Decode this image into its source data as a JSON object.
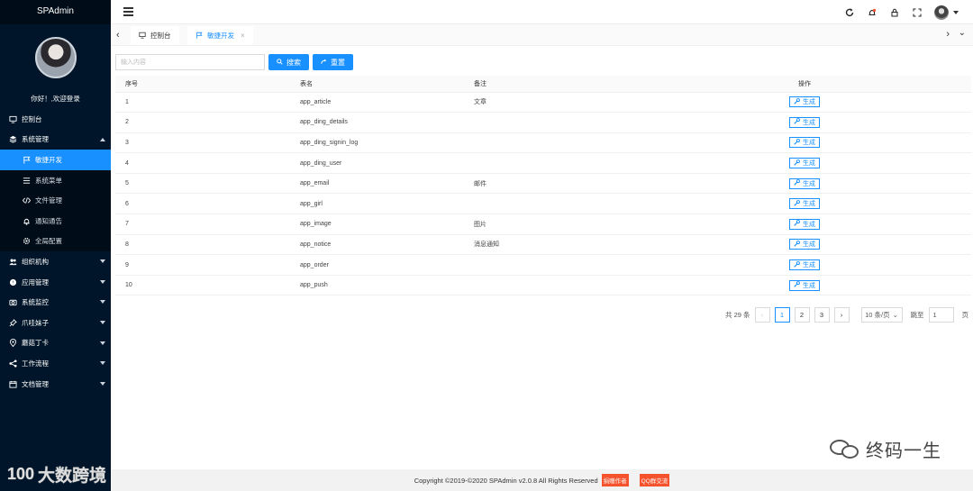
{
  "sidebar": {
    "title": "SPAdmin",
    "welcome": "你好！,欢迎登录",
    "items": [
      {
        "label": "控制台",
        "icon": "monitor-icon"
      },
      {
        "label": "系统管理",
        "icon": "layers-icon",
        "expanded": true,
        "children": [
          {
            "label": "敏捷开发",
            "icon": "flag-icon",
            "active": true
          },
          {
            "label": "系统菜单",
            "icon": "list-icon"
          },
          {
            "label": "文件管理",
            "icon": "code-icon"
          },
          {
            "label": "通知通告",
            "icon": "bell-icon"
          },
          {
            "label": "全局配置",
            "icon": "gear-icon"
          }
        ]
      },
      {
        "label": "组织机构",
        "icon": "users-icon"
      },
      {
        "label": "应用管理",
        "icon": "app-icon"
      },
      {
        "label": "系统监控",
        "icon": "camera-icon"
      },
      {
        "label": "爪哇妹子",
        "icon": "pin-icon"
      },
      {
        "label": "蘑菇丁卡",
        "icon": "location-icon"
      },
      {
        "label": "工作流程",
        "icon": "share-icon"
      },
      {
        "label": "文档管理",
        "icon": "calendar-icon"
      }
    ]
  },
  "tabs": [
    {
      "label": "控制台",
      "icon": "monitor-icon"
    },
    {
      "label": "敏捷开发",
      "icon": "flag-icon",
      "active": true,
      "closable": "×"
    }
  ],
  "search": {
    "placeholder": "输入内容",
    "search_label": "搜索",
    "reset_label": "重置"
  },
  "table": {
    "headers": [
      "序号",
      "表名",
      "备注",
      "操作"
    ],
    "action_label": "生成",
    "rows": [
      {
        "no": "1",
        "name": "app_article",
        "remark": "文章"
      },
      {
        "no": "2",
        "name": "app_ding_details",
        "remark": ""
      },
      {
        "no": "3",
        "name": "app_ding_signin_log",
        "remark": ""
      },
      {
        "no": "4",
        "name": "app_ding_user",
        "remark": ""
      },
      {
        "no": "5",
        "name": "app_email",
        "remark": "邮件"
      },
      {
        "no": "6",
        "name": "app_girl",
        "remark": ""
      },
      {
        "no": "7",
        "name": "app_image",
        "remark": "图片"
      },
      {
        "no": "8",
        "name": "app_notice",
        "remark": "消息通知"
      },
      {
        "no": "9",
        "name": "app_order",
        "remark": ""
      },
      {
        "no": "10",
        "name": "app_push",
        "remark": ""
      }
    ]
  },
  "pagination": {
    "total": "共 29 条",
    "pages": [
      "1",
      "2",
      "3"
    ],
    "current": "1",
    "page_size": "10 条/页",
    "goto_prefix": "跳至",
    "goto_value": "1",
    "goto_suffix": "页"
  },
  "footer": {
    "copyright": "Copyright ©2019-©2020 SPAdmin v2.0.8 All Rights Reserved",
    "badge1": "捐赠作者",
    "badge2": "QQ群交流"
  },
  "watermark": {
    "right": "终码一生",
    "left_prefix": "100",
    "left": "大数跨境"
  },
  "colors": {
    "sidebar_bg": "#001529",
    "primary": "#1890ff",
    "badge": "#f5522d"
  }
}
